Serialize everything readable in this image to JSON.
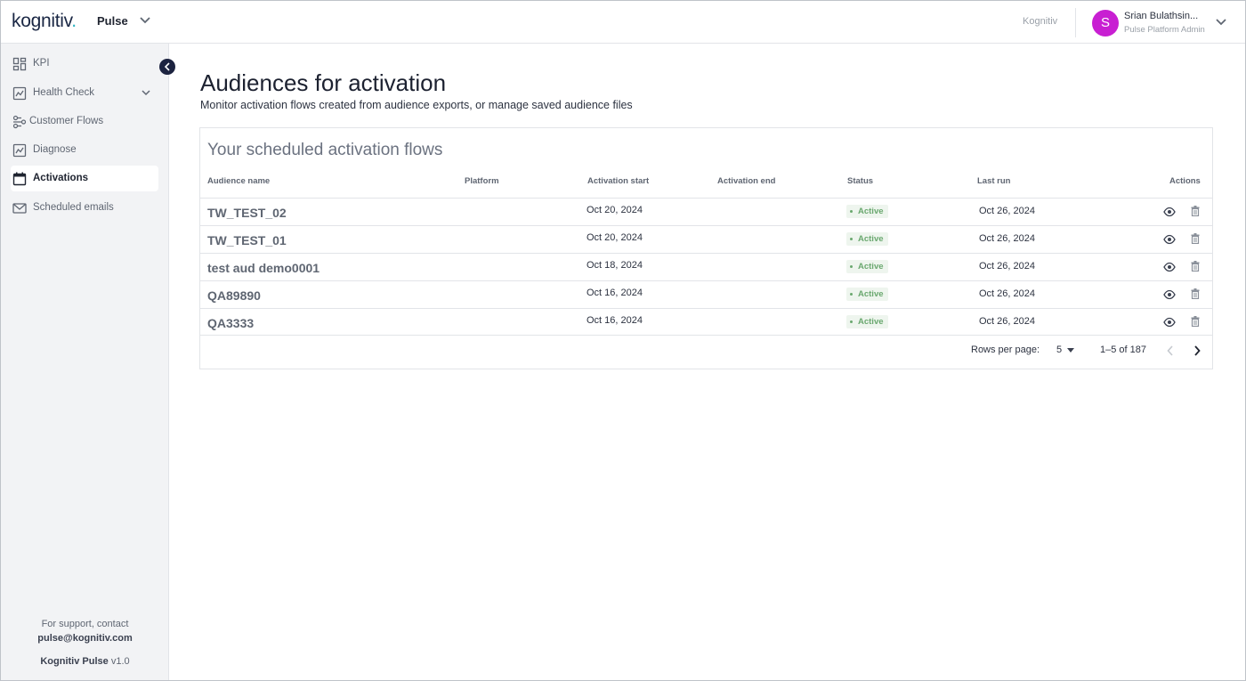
{
  "header": {
    "logo_text": "kognitiv",
    "logo_dot": ".",
    "app_name": "Pulse",
    "org_name": "Kognitiv",
    "user": {
      "initial": "S",
      "name": "Srian Bulathsin...",
      "role": "Pulse Platform Admin",
      "avatar_color": "#c81fd2"
    }
  },
  "sidebar": {
    "items": [
      {
        "label": "KPI",
        "icon": "dashboard-icon"
      },
      {
        "label": "Health Check",
        "icon": "chart-icon",
        "expandable": true
      },
      {
        "label": "Customer Flows",
        "icon": "flows-icon"
      },
      {
        "label": "Diagnose",
        "icon": "chart-icon"
      },
      {
        "label": "Activations",
        "icon": "calendar-icon",
        "active": true
      },
      {
        "label": "Scheduled emails",
        "icon": "mail-icon"
      }
    ],
    "support_line": "For support, contact",
    "support_email": "pulse@kognitiv.com",
    "version_name": "Kognitiv Pulse",
    "version_number": "v1.0"
  },
  "main": {
    "title": "Audiences for activation",
    "subtitle": "Monitor activation flows created from audience exports, or manage saved audience files",
    "card_title": "Your scheduled activation flows",
    "columns": [
      "Audience name",
      "Platform",
      "Activation start",
      "Activation end",
      "Status",
      "Last run",
      "Actions"
    ],
    "rows": [
      {
        "name": "TW_TEST_02",
        "platform": "",
        "start": "Oct 20, 2024",
        "end": "",
        "status": "Active",
        "last_run": "Oct 26, 2024"
      },
      {
        "name": "TW_TEST_01",
        "platform": "",
        "start": "Oct 20, 2024",
        "end": "",
        "status": "Active",
        "last_run": "Oct 26, 2024"
      },
      {
        "name": "test aud demo0001",
        "platform": "",
        "start": "Oct 18, 2024",
        "end": "",
        "status": "Active",
        "last_run": "Oct 26, 2024"
      },
      {
        "name": "QA89890",
        "platform": "",
        "start": "Oct 16, 2024",
        "end": "",
        "status": "Active",
        "last_run": "Oct 26, 2024"
      },
      {
        "name": "QA3333",
        "platform": "",
        "start": "Oct 16, 2024",
        "end": "",
        "status": "Active",
        "last_run": "Oct 26, 2024"
      }
    ],
    "pagination": {
      "rows_per_page_label": "Rows per page:",
      "rows_per_page_value": "5",
      "range": "1–5 of 187"
    }
  },
  "colors": {
    "accent_dark": "#1c2340",
    "status_active": "#6aa86f",
    "status_active_bg": "#eef5ee",
    "sidebar_bg": "#f2f3f5"
  }
}
